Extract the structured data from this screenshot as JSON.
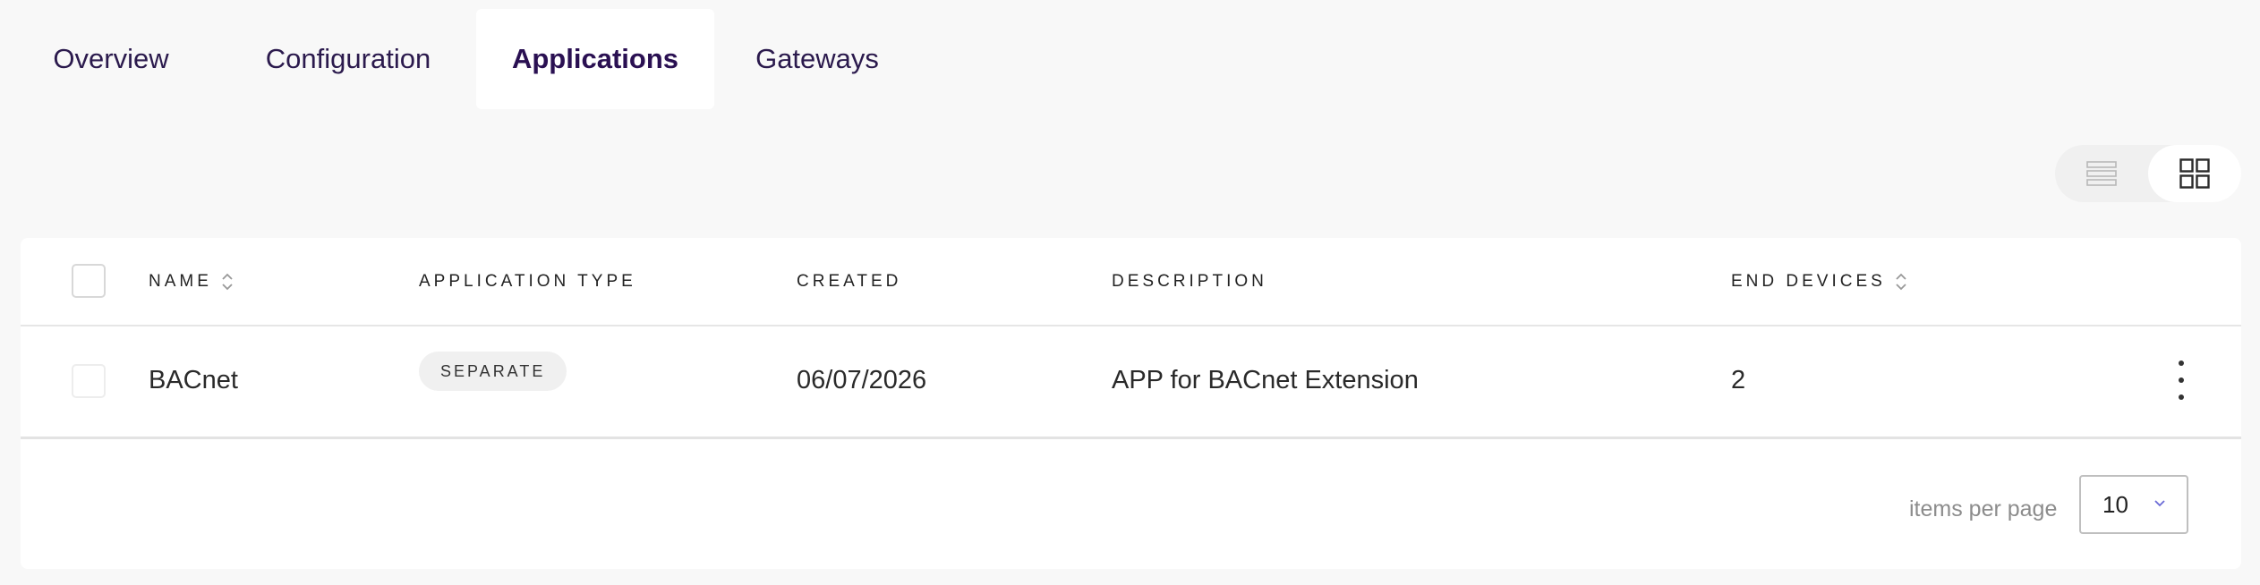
{
  "tabs": [
    {
      "label": "Overview",
      "active": false
    },
    {
      "label": "Configuration",
      "active": false
    },
    {
      "label": "Applications",
      "active": true
    },
    {
      "label": "Gateways",
      "active": false
    }
  ],
  "view_toggle": {
    "list_icon": "list-view-icon",
    "grid_icon": "grid-view-icon",
    "selected": "grid"
  },
  "table": {
    "columns": [
      "NAME",
      "APPLICATION TYPE",
      "CREATED",
      "DESCRIPTION",
      "END DEVICES"
    ],
    "rows": [
      {
        "name": "BACnet",
        "type": "SEPARATE",
        "created": "06/07/2026",
        "description": "APP for BACnet Extension",
        "end_devices": "2"
      }
    ]
  },
  "pagination": {
    "items_per_page_label": "items per page",
    "items_per_page_value": "10"
  },
  "colors": {
    "accent": "#2a1052",
    "background": "#f8f8f8",
    "card": "#ffffff"
  }
}
